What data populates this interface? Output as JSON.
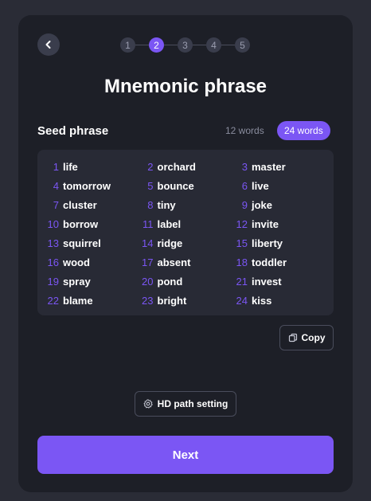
{
  "header": {
    "title": "Mnemonic phrase",
    "steps": [
      "1",
      "2",
      "3",
      "4",
      "5"
    ],
    "active_step": 2
  },
  "seed": {
    "label": "Seed phrase",
    "toggle_12": "12 words",
    "toggle_24": "24 words",
    "words": [
      {
        "num": "1",
        "word": "life"
      },
      {
        "num": "2",
        "word": "orchard"
      },
      {
        "num": "3",
        "word": "master"
      },
      {
        "num": "4",
        "word": "tomorrow"
      },
      {
        "num": "5",
        "word": "bounce"
      },
      {
        "num": "6",
        "word": "live"
      },
      {
        "num": "7",
        "word": "cluster"
      },
      {
        "num": "8",
        "word": "tiny"
      },
      {
        "num": "9",
        "word": "joke"
      },
      {
        "num": "10",
        "word": "borrow"
      },
      {
        "num": "11",
        "word": "label"
      },
      {
        "num": "12",
        "word": "invite"
      },
      {
        "num": "13",
        "word": "squirrel"
      },
      {
        "num": "14",
        "word": "ridge"
      },
      {
        "num": "15",
        "word": "liberty"
      },
      {
        "num": "16",
        "word": "wood"
      },
      {
        "num": "17",
        "word": "absent"
      },
      {
        "num": "18",
        "word": "toddler"
      },
      {
        "num": "19",
        "word": "spray"
      },
      {
        "num": "20",
        "word": "pond"
      },
      {
        "num": "21",
        "word": "invest"
      },
      {
        "num": "22",
        "word": "blame"
      },
      {
        "num": "23",
        "word": "bright"
      },
      {
        "num": "24",
        "word": "kiss"
      }
    ]
  },
  "actions": {
    "copy_label": "Copy",
    "hd_path_label": "HD path setting",
    "next_label": "Next"
  },
  "icons": {
    "back": "chevron-left-icon",
    "copy": "copy-icon",
    "settings": "gear-icon"
  },
  "colors": {
    "accent": "#7b56f4",
    "background": "#2a2c36",
    "card": "#1d1f27",
    "panel": "#282a35"
  }
}
